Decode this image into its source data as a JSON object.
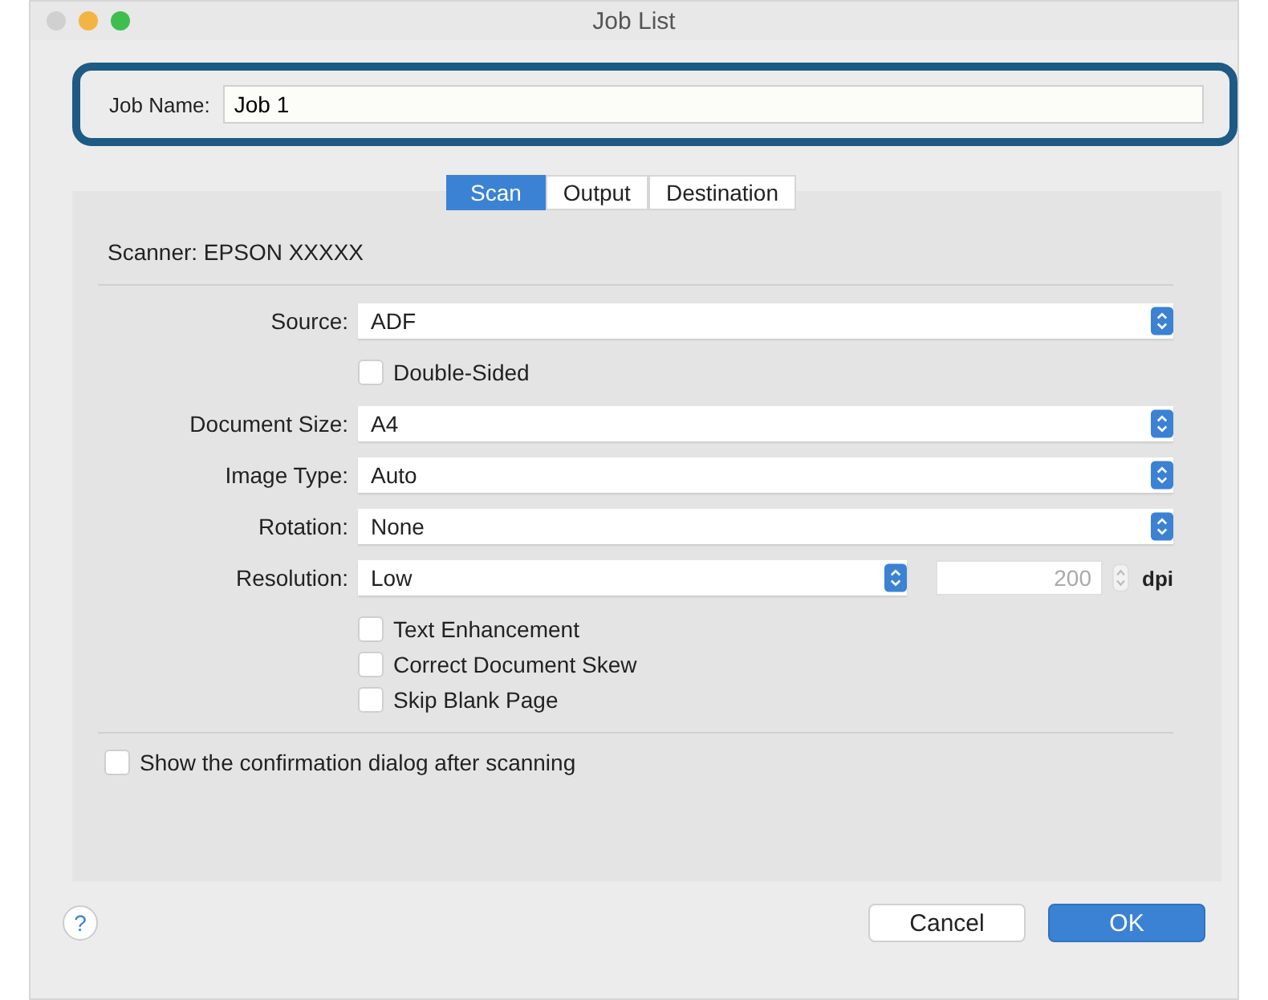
{
  "window": {
    "title": "Job List"
  },
  "job_name": {
    "label": "Job Name:",
    "value": "Job 1"
  },
  "tabs": [
    {
      "label": "Scan",
      "selected": true
    },
    {
      "label": "Output",
      "selected": false
    },
    {
      "label": "Destination",
      "selected": false
    }
  ],
  "scanner": "Scanner: EPSON XXXXX",
  "rows": [
    {
      "kind": "select",
      "label": "Source:",
      "value": "ADF"
    },
    {
      "kind": "checkbox",
      "label": "Double-Sided",
      "checked": false
    },
    {
      "kind": "select",
      "label": "Document Size:",
      "value": "A4"
    },
    {
      "kind": "select",
      "label": "Image Type:",
      "value": "Auto"
    },
    {
      "kind": "select",
      "label": "Rotation:",
      "value": "None"
    },
    {
      "kind": "resolution",
      "label": "Resolution:",
      "value": "Low",
      "number": "200",
      "unit": "dpi"
    }
  ],
  "options": [
    {
      "label": "Text Enhancement",
      "checked": false
    },
    {
      "label": "Correct Document Skew",
      "checked": false
    },
    {
      "label": "Skip Blank Page",
      "checked": false
    }
  ],
  "confirm": {
    "label": "Show the confirmation dialog after scanning",
    "checked": false
  },
  "help": "?",
  "buttons": [
    {
      "label": "Cancel",
      "kind": "secondary"
    },
    {
      "label": "OK",
      "kind": "primary"
    }
  ]
}
